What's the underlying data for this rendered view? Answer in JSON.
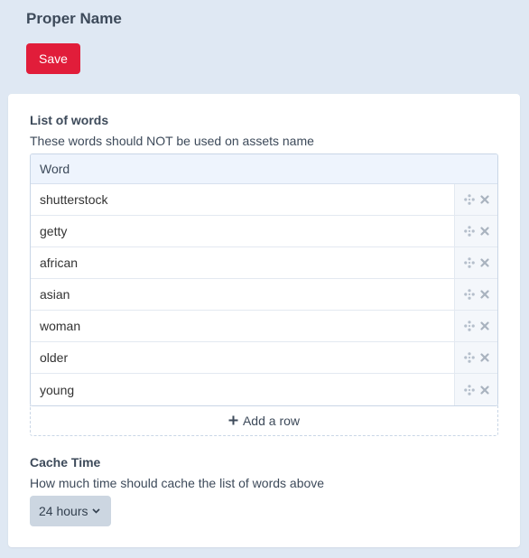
{
  "header": {
    "title": "Proper Name",
    "save_label": "Save"
  },
  "words_section": {
    "label": "List of words",
    "help": "These words should NOT be used on assets name",
    "column_header": "Word",
    "rows": [
      "shutterstock",
      "getty",
      "african",
      "asian",
      "woman",
      "older",
      "young"
    ],
    "add_row_label": "Add a row"
  },
  "cache_section": {
    "label": "Cache Time",
    "help": "How much time should cache the list of words above",
    "selected": "24 hours"
  },
  "icons": {
    "drag": "drag-handle-icon",
    "delete": "close-icon",
    "add": "plus-icon",
    "dropdown": "chevron-down-icon"
  },
  "colors": {
    "save_button": "#e11d3a",
    "page_background": "#dfe8f3"
  }
}
